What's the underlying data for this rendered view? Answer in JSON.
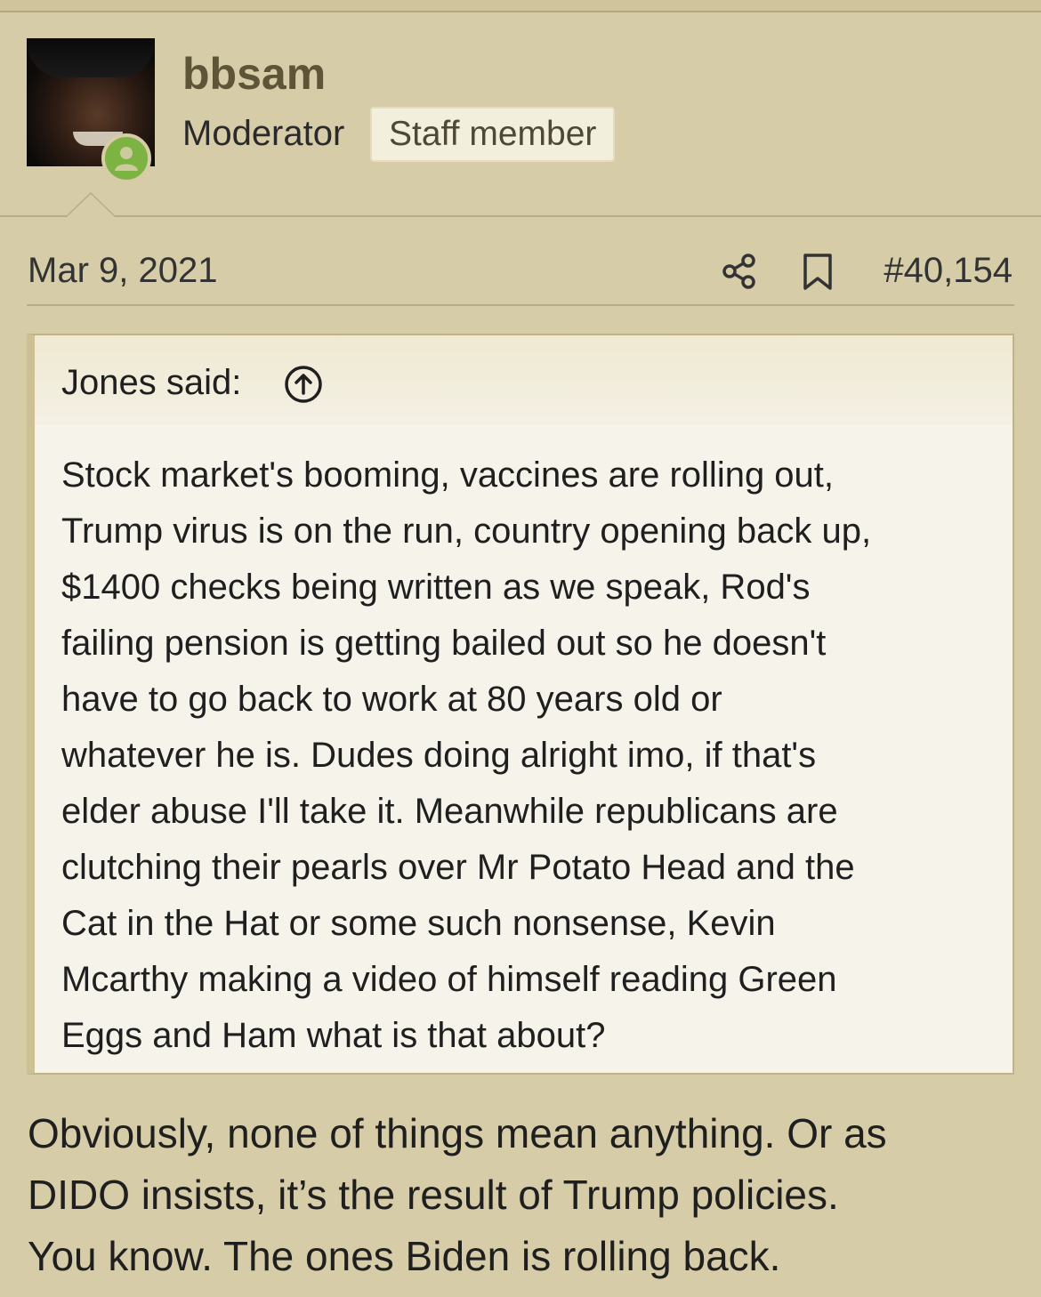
{
  "user": {
    "name": "bbsam",
    "role": "Moderator",
    "badge": "Staff member",
    "avatar_icon": "user-avatar",
    "status_icon": "online-user-icon",
    "status_color": "#7cb342"
  },
  "post": {
    "date": "Mar 9, 2021",
    "number": "#40,154",
    "share_icon": "share-icon",
    "bookmark_icon": "bookmark-icon"
  },
  "quote": {
    "author": "Jones said:",
    "jump_icon": "arrow-up-circle-icon",
    "text": "Stock market's booming, vaccines are rolling out,\nTrump virus is on the run, country opening back up,\n$1400 checks being written as we speak, Rod's\nfailing pension is getting bailed out so he doesn't\nhave to go back to work at 80 years old or\nwhatever he is. Dudes doing alright imo, if that's\nelder abuse I'll take it. Meanwhile republicans are\nclutching their pearls over Mr Potato Head and the\nCat in the Hat or some such nonsense, Kevin\nMcarthy making a video of himself reading Green\nEggs and Ham what is that about?"
  },
  "reply": {
    "text": "Obviously, none of things mean anything. Or as\nDIDO insists, it’s the result of Trump policies.\nYou know. The ones Biden is rolling back."
  },
  "colors": {
    "background": "#d6cca7",
    "quote_background": "#f6f3ea",
    "username": "#5e5539"
  }
}
